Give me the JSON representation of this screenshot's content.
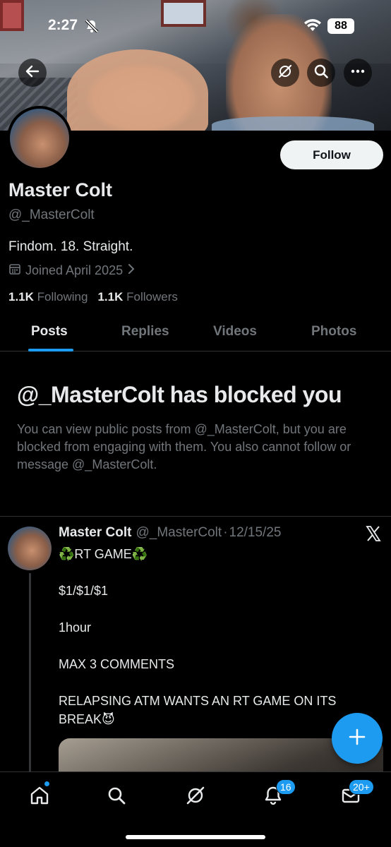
{
  "status_bar": {
    "time": "2:27",
    "battery": "88"
  },
  "profile": {
    "display_name": "Master Colt",
    "handle": "@_MasterColt",
    "bio": "Findom. 18. Straight.",
    "joined": "Joined April 2025",
    "following_count": "1.1K",
    "following_label": "Following",
    "followers_count": "1.1K",
    "followers_label": "Followers",
    "follow_button": "Follow"
  },
  "tabs": [
    {
      "label": "Posts",
      "active": true
    },
    {
      "label": "Replies",
      "active": false
    },
    {
      "label": "Videos",
      "active": false
    },
    {
      "label": "Photos",
      "active": false
    }
  ],
  "blocked_notice": {
    "title": "@_MasterColt has blocked you",
    "body": "You can view public posts from @_MasterColt, but you are blocked from engaging with them. You also cannot follow or message @_MasterColt."
  },
  "post": {
    "author_name": "Master Colt",
    "author_handle": "@_MasterColt",
    "separator": "·",
    "date": "12/15/25",
    "text": "♻️RT GAME♻️\n\n$1/$1/$1\n\n1hour\n\nMAX 3 COMMENTS\n\nRELAPSING ATM WANTS AN RT GAME ON ITS BREAK😈"
  },
  "bottom_nav": {
    "notifications_badge": "16",
    "messages_badge": "20+"
  },
  "colors": {
    "accent": "#1d9bf0",
    "background": "#000000",
    "text_primary": "#e7e9ea",
    "text_secondary": "#71767b"
  },
  "icons": {
    "back": "arrow-left-icon",
    "grok": "grok-icon",
    "search": "search-icon",
    "more": "more-icon",
    "calendar": "calendar-icon",
    "chevron": "chevron-right-icon",
    "x_logo": "x-logo-icon",
    "compose": "plus-icon",
    "home": "home-icon",
    "notifications": "bell-icon",
    "messages": "mail-icon"
  }
}
